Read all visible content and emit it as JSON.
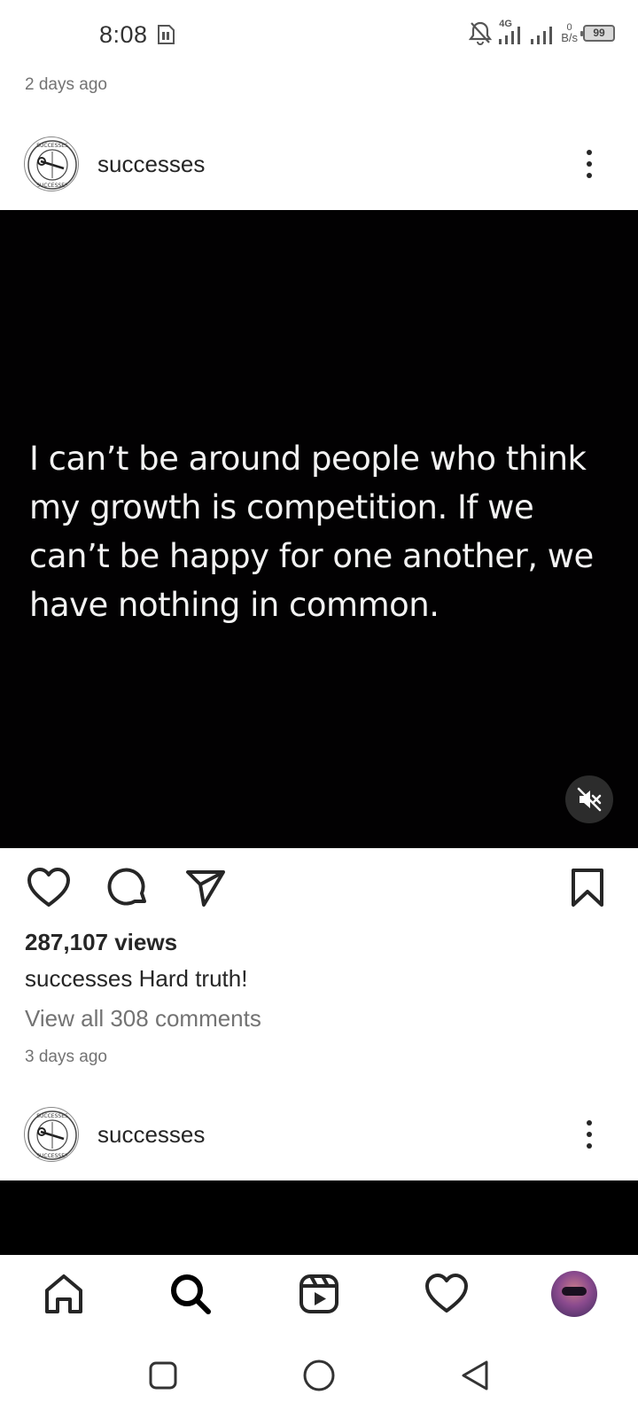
{
  "status_bar": {
    "time": "8:08",
    "network_type": "4G",
    "data_rate_value": "0",
    "data_rate_unit": "B/s",
    "battery_level": "99",
    "icons": [
      "sim-card-icon",
      "bell-off-icon",
      "signal-icon",
      "signal-icon",
      "battery-icon"
    ]
  },
  "feed": {
    "previous_post_timestamp": "2 days ago",
    "posts": [
      {
        "username": "successes",
        "media_text": "I can’t be around people who think my growth is competition. If we can’t be happy for one another, we have nothing in common.",
        "views": "287,107 views",
        "caption_user": "successes",
        "caption_text": "Hard truth!",
        "comments_link": "View all 308 comments",
        "timestamp": "3 days ago"
      },
      {
        "username": "successes"
      }
    ]
  },
  "actions": {
    "icons": [
      "heart-icon",
      "comment-icon",
      "share-icon",
      "bookmark-icon"
    ]
  },
  "bottom_nav": {
    "items": [
      "home-icon",
      "search-icon",
      "reels-icon",
      "heart-icon",
      "profile-avatar"
    ]
  },
  "system_nav": {
    "items": [
      "recents-button",
      "home-button",
      "back-button"
    ]
  }
}
